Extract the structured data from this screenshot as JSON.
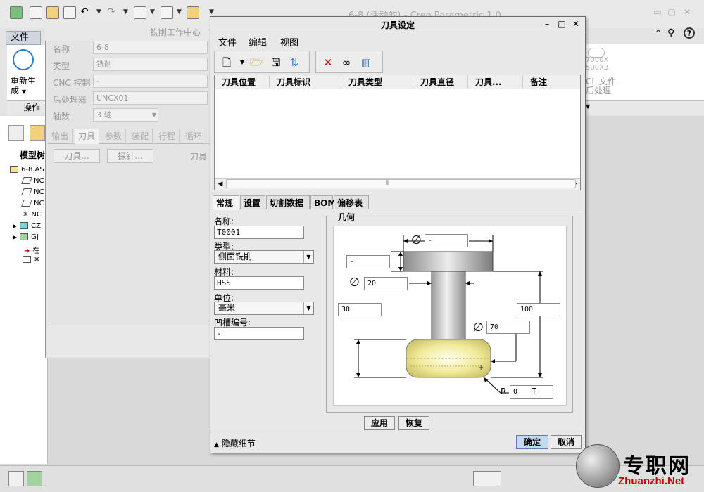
{
  "app": {
    "title": "6-8 (活动的) - Creo Parametric 1.0",
    "file_menu": "文件",
    "regen_label_1": "重新生",
    "regen_label_2": "成",
    "operations_label": "操作",
    "model_tree_label": "模型树",
    "ribbon_right_text_1": "7000X",
    "ribbon_right_text_2": "500X3.",
    "ribbon_right_text_3": "CL 文件",
    "ribbon_right_text_4": "后处理",
    "tree_items": [
      "6-8.AS",
      "NC",
      "NC",
      "NC",
      "NC",
      "CZ",
      "GJ",
      "在",
      "※"
    ]
  },
  "mill_work_center": {
    "title": "铣削工作中心",
    "fields": [
      {
        "label": "名称",
        "value": "6-8"
      },
      {
        "label": "类型",
        "value": "铣削"
      },
      {
        "label": "CNC 控制",
        "value": "-"
      },
      {
        "label": "后处理器",
        "value": "UNCX01"
      },
      {
        "label": "轴数",
        "value": "3 轴"
      }
    ],
    "tabs": [
      "输出",
      "刀具",
      "参数",
      "装配",
      "行程",
      "循环"
    ],
    "tools_button": "刀具...",
    "probe_button": "探针...",
    "tool_label": "刀具"
  },
  "tool_dialog": {
    "title": "刀具设定",
    "menus": [
      "文件",
      "编辑",
      "视图"
    ],
    "table_columns": [
      "刀具位置",
      "刀具标识",
      "刀具类型",
      "刀具直径",
      "刀具...",
      "备注"
    ],
    "param_tabs": [
      "常规",
      "设置",
      "切割数据",
      "BOM",
      "偏移表"
    ],
    "name_label": "名称:",
    "name_value": "T0001",
    "type_label": "类型:",
    "type_value": "侧面铣削",
    "material_label": "材料:",
    "material_value": "HSS",
    "unit_label": "单位:",
    "unit_value": "毫米",
    "groove_label": "凹槽编号:",
    "groove_value": "-",
    "geometry_label": "几何",
    "geometry": {
      "top_diameter": "-",
      "top_height": "-",
      "shank_diameter": "20",
      "shank_length": "30",
      "total_length": "100",
      "cutter_diameter": "70",
      "radius_label": "R",
      "radius": "0"
    },
    "apply_button": "应用",
    "restore_button": "恢复",
    "hide_details": "隐藏细节",
    "ok_button": "确定",
    "cancel_button": "取消"
  },
  "watermark": {
    "cn": "专职网",
    "en": "Zhuanzhi.Net"
  }
}
